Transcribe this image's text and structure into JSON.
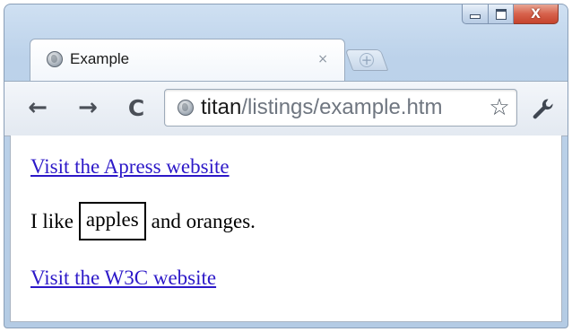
{
  "window": {
    "caption_buttons": {
      "minimize_icon": "minimize-icon",
      "maximize_icon": "maximize-icon",
      "close_label": "X"
    }
  },
  "tab": {
    "title": "Example",
    "close_label": "×",
    "favicon": "globe-icon"
  },
  "new_tab": {
    "label": "+"
  },
  "toolbar": {
    "back_label": "←",
    "forward_label": "→",
    "reload_label": "C",
    "url_host": "titan",
    "url_path": "/listings/example.htm",
    "star_label": "☆",
    "wrench_icon": "wrench-icon"
  },
  "page": {
    "link1": "Visit the Apress website",
    "sentence_start": "I like",
    "boxed_word": "apples",
    "sentence_end": "and oranges.",
    "link2": "Visit the W3C website"
  },
  "colors": {
    "link": "#2c18c8",
    "frame": "#bcd2ea",
    "close_button": "#d7624c"
  }
}
